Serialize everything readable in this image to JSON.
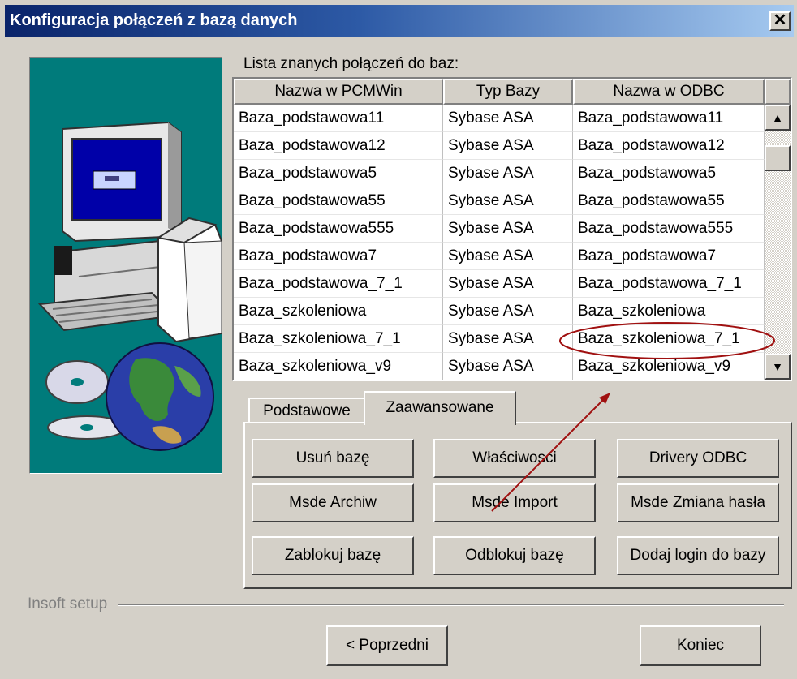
{
  "window": {
    "title": "Konfiguracja połączeń z bazą danych",
    "close_glyph": "✕"
  },
  "list": {
    "label": "Lista znanych połączeń do baz:",
    "columns": [
      "Nazwa w PCMWin",
      "Typ Bazy",
      "Nazwa w ODBC"
    ],
    "rows": [
      [
        "Baza_podstawowa11",
        "Sybase ASA",
        "Baza_podstawowa11"
      ],
      [
        "Baza_podstawowa12",
        "Sybase ASA",
        "Baza_podstawowa12"
      ],
      [
        "Baza_podstawowa5",
        "Sybase ASA",
        "Baza_podstawowa5"
      ],
      [
        "Baza_podstawowa55",
        "Sybase ASA",
        "Baza_podstawowa55"
      ],
      [
        "Baza_podstawowa555",
        "Sybase ASA",
        "Baza_podstawowa555"
      ],
      [
        "Baza_podstawowa7",
        "Sybase ASA",
        "Baza_podstawowa7"
      ],
      [
        "Baza_podstawowa_7_1",
        "Sybase ASA",
        "Baza_podstawowa_7_1"
      ],
      [
        "Baza_szkoleniowa",
        "Sybase ASA",
        "Baza_szkoleniowa"
      ],
      [
        "Baza_szkoleniowa_7_1",
        "Sybase ASA",
        "Baza_szkoleniowa_7_1"
      ],
      [
        "Baza_szkoleniowa_v9",
        "Sybase ASA",
        "Baza_szkoleniowa_v9"
      ]
    ]
  },
  "tabs": {
    "basic": "Podstawowe",
    "advanced": "Zaawansowane"
  },
  "buttons": {
    "remove_db": "Usuń bazę",
    "properties": "Właściwosci",
    "odbc_drivers": "Drivery ODBC",
    "msde_archive": "Msde Archiw",
    "msde_import": "Msde Import",
    "msde_password": "Msde Zmiana hasła",
    "lock_db": "Zablokuj bazę",
    "unlock_db": "Odblokuj bazę",
    "add_login": "Dodaj login do bazy"
  },
  "footer": {
    "group_label": "Insoft setup",
    "back": "< Poprzedni",
    "finish": "Koniec"
  },
  "colors": {
    "title_start": "#0a246a",
    "title_end": "#a6caf0",
    "image_bg": "#007b7b",
    "annotation": "#a01010"
  }
}
